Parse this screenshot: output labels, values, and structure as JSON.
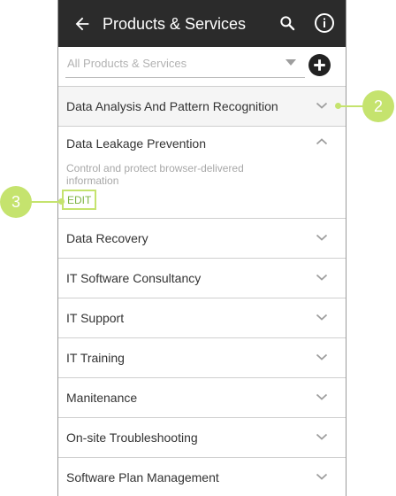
{
  "header": {
    "title": "Products & Services"
  },
  "filter": {
    "selected": "All Products & Services"
  },
  "list": {
    "items": [
      {
        "label": "Data Analysis And Pattern Recognition"
      },
      {
        "label": "Data Leakage Prevention",
        "description": "Control and protect browser-delivered information",
        "edit_label": "EDIT"
      },
      {
        "label": "Data Recovery"
      },
      {
        "label": "IT Software Consultancy"
      },
      {
        "label": "IT Support"
      },
      {
        "label": "IT Training"
      },
      {
        "label": "Manitenance"
      },
      {
        "label": "On-site Troubleshooting"
      },
      {
        "label": "Software Plan Management"
      }
    ]
  },
  "callouts": {
    "two": "2",
    "three": "3"
  },
  "colors": {
    "appbar": "#2b2b2b",
    "accent": "#c5e36e",
    "edit_text": "#7cb342"
  }
}
